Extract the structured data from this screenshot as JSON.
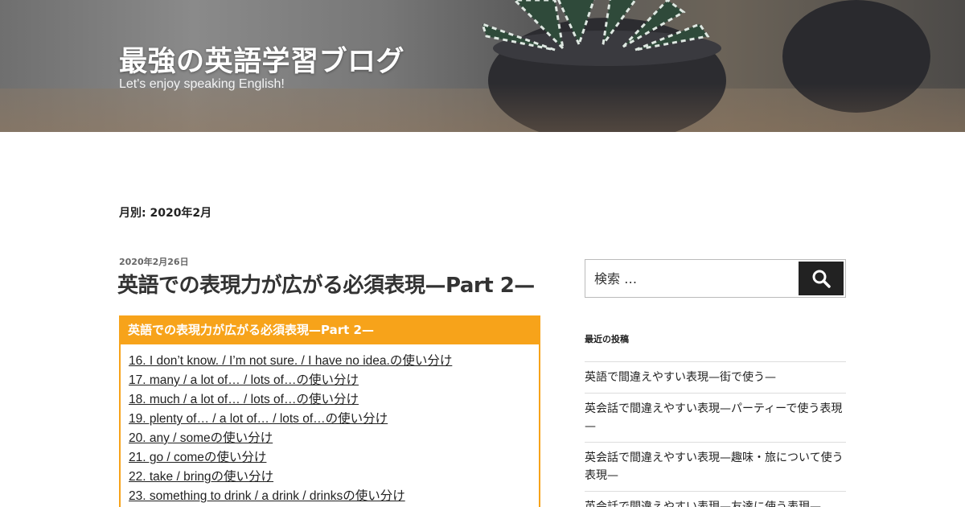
{
  "header": {
    "title": "最強の英語学習ブログ",
    "description": "Let's enjoy speaking English!"
  },
  "archive": {
    "title": "月別: 2020年2月"
  },
  "post": {
    "date": "2020年2月26日",
    "title": "英語での表現力が広がる必須表現—Part 2—",
    "toc_title": "英語での表現力が広がる必須表現—Part 2—",
    "toc_items": [
      "16. I don’t know. / I’m not sure. / I have no idea.の使い分け",
      "17. many / a lot of… / lots of…の使い分け",
      "18. much / a lot of… / lots of…の使い分け",
      "19. plenty of… / a lot of… / lots of…の使い分け",
      "20. any / someの使い分け",
      "21. go / comeの使い分け",
      "22. take / bringの使い分け",
      "23. something to drink / a drink / drinksの使い分け"
    ]
  },
  "sidebar": {
    "search_placeholder": "検索 …",
    "recent_title": "最近の投稿",
    "recent_posts": [
      "英語で間違えやすい表現—街で使う—",
      "英会話で間違えやすい表現—パーティーで使う表現—",
      "英会話で間違えやすい表現—趣味・旅について使う表現—",
      "英会話で間違えやすい表現—友達に使う表現—"
    ]
  },
  "colors": {
    "accent": "#f7a31a",
    "button": "#222222"
  },
  "icons": {
    "search": "search-icon"
  }
}
